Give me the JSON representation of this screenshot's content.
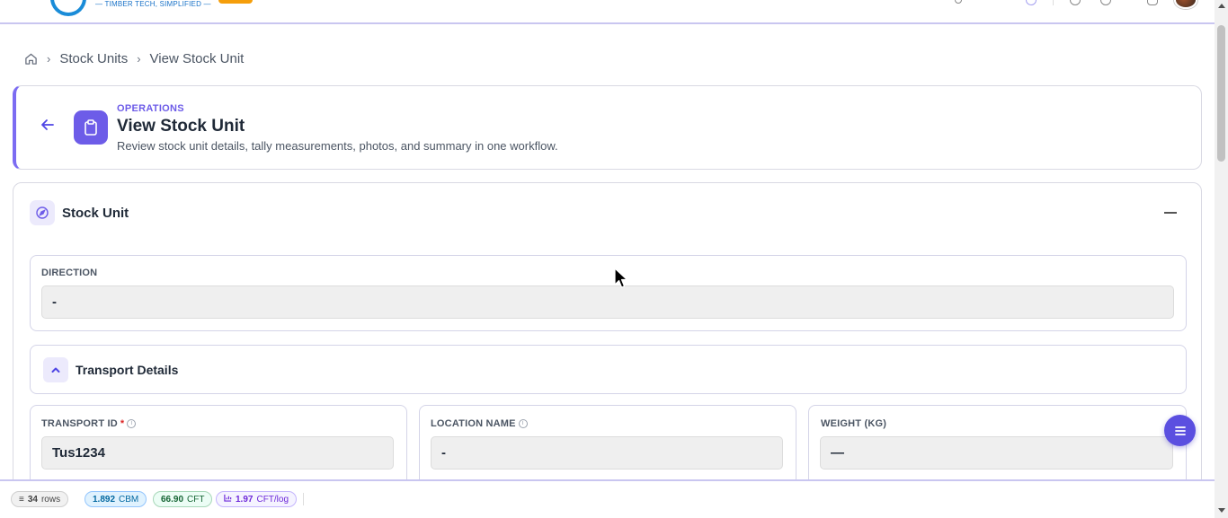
{
  "topbar": {
    "tagline": "— TIMBER TECH, SIMPLIFIED —"
  },
  "breadcrumb": {
    "items": [
      "Stock Units",
      "View Stock Unit"
    ]
  },
  "header": {
    "kicker": "OPERATIONS",
    "title": "View Stock Unit",
    "subtitle": "Review stock unit details, tally measurements, photos, and summary in one workflow."
  },
  "stock_unit": {
    "title": "Stock Unit",
    "direction": {
      "label": "DIRECTION",
      "value": "-"
    },
    "transport": {
      "title": "Transport Details",
      "fields": [
        {
          "label": "TRANSPORT ID",
          "value": "Tus1234",
          "required": "*"
        },
        {
          "label": "LOCATION NAME",
          "value": "-"
        },
        {
          "label": "WEIGHT (KG)",
          "value": "—"
        }
      ]
    }
  },
  "status": {
    "rows_value": "34",
    "rows_label": "rows",
    "cbm_value": "1.892",
    "cbm_label": "CBM",
    "cft_value": "66.90",
    "cft_label": "CFT",
    "log_value": "1.97",
    "log_label": "CFT/log"
  },
  "colors": {
    "accent": "#6d5ce8",
    "brand_blue": "#1a8cd8"
  }
}
